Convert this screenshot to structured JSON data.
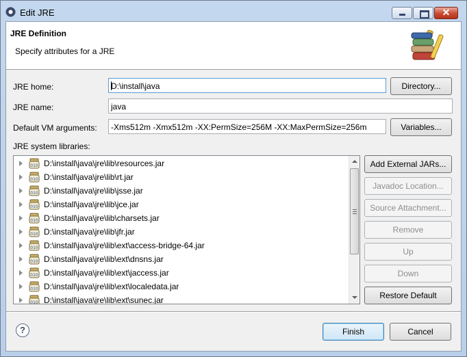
{
  "window": {
    "title": "Edit JRE",
    "min_glyph": "minimize",
    "max_glyph": "maximize",
    "close_glyph": "✕"
  },
  "header": {
    "title": "JRE Definition",
    "subtitle": "Specify attributes for a JRE",
    "banner_icon": "books-icon"
  },
  "form": {
    "jre_home_label": "JRE home:",
    "jre_home_value": "D:\\install\\java",
    "directory_button": "Directory...",
    "jre_name_label": "JRE name:",
    "jre_name_value": "java",
    "vm_args_label": "Default VM arguments:",
    "vm_args_value": "-Xms512m -Xmx512m -XX:PermSize=256M -XX:MaxPermSize=256m",
    "variables_button": "Variables...",
    "libraries_label": "JRE system libraries:"
  },
  "libraries": [
    "D:\\install\\java\\jre\\lib\\resources.jar",
    "D:\\install\\java\\jre\\lib\\rt.jar",
    "D:\\install\\java\\jre\\lib\\jsse.jar",
    "D:\\install\\java\\jre\\lib\\jce.jar",
    "D:\\install\\java\\jre\\lib\\charsets.jar",
    "D:\\install\\java\\jre\\lib\\jfr.jar",
    "D:\\install\\java\\jre\\lib\\ext\\access-bridge-64.jar",
    "D:\\install\\java\\jre\\lib\\ext\\dnsns.jar",
    "D:\\install\\java\\jre\\lib\\ext\\jaccess.jar",
    "D:\\install\\java\\jre\\lib\\ext\\localedata.jar",
    "D:\\install\\java\\jre\\lib\\ext\\sunec.jar"
  ],
  "side_buttons": {
    "add_external_jars": "Add External JARs...",
    "javadoc_location": "Javadoc Location...",
    "source_attachment": "Source Attachment...",
    "remove": "Remove",
    "up": "Up",
    "down": "Down",
    "restore_default": "Restore Default"
  },
  "footer": {
    "help_glyph": "?",
    "finish": "Finish",
    "cancel": "Cancel"
  },
  "colors": {
    "accent": "#3c7fb1",
    "title_bar": "#c3d7ee",
    "close_button": "#c94a31"
  }
}
